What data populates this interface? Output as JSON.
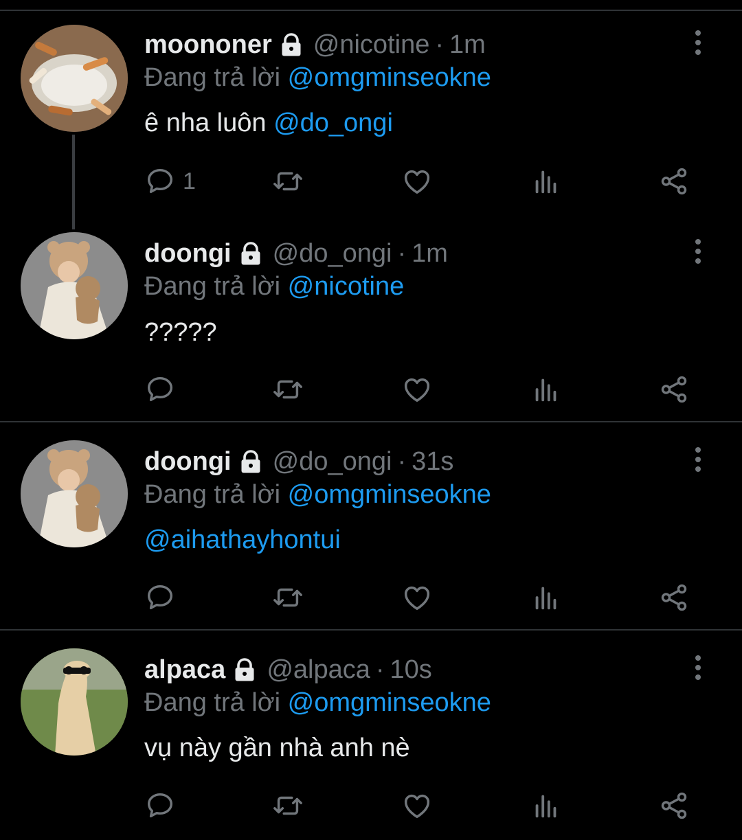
{
  "tweets": [
    {
      "name": "moononer",
      "handle": "@nicotine",
      "time": "1m",
      "replying_prefix": "Đang trả lời",
      "replying_to": "@omgminseokne",
      "text": "ê nha luôn",
      "text_mention": "@do_ongi",
      "reply_count": "1"
    },
    {
      "name": "doongi",
      "handle": "@do_ongi",
      "time": "1m",
      "replying_prefix": "Đang trả lời",
      "replying_to": "@nicotine",
      "text": "?????",
      "text_mention": "",
      "reply_count": ""
    },
    {
      "name": "doongi",
      "handle": "@do_ongi",
      "time": "31s",
      "replying_prefix": "Đang trả lời",
      "replying_to": "@omgminseokne",
      "text": "",
      "text_mention": "@aihathayhontui",
      "reply_count": ""
    },
    {
      "name": "alpaca",
      "handle": "@alpaca",
      "time": "10s",
      "replying_prefix": "Đang trả lời",
      "replying_to": "@omgminseokne",
      "text": "vụ này gần nhà anh nè",
      "text_mention": "",
      "reply_count": ""
    }
  ],
  "separator": "·",
  "icons": [
    "lock-icon",
    "more-icon",
    "reply-icon",
    "retweet-icon",
    "like-icon",
    "views-icon",
    "share-icon"
  ],
  "colors": {
    "background": "#000000",
    "text": "#e7e9ea",
    "muted": "#71767b",
    "accent": "#1d9bf0"
  }
}
